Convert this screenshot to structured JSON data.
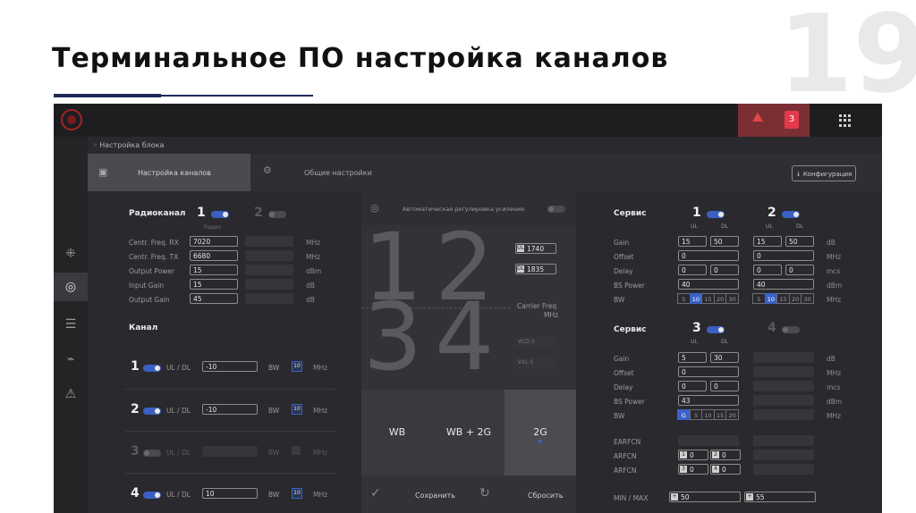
{
  "slide": {
    "title": "Терминальное ПО настройка каналов",
    "page_number": "19"
  },
  "topbar": {
    "alarm_count": "3"
  },
  "breadcrumb": "Настройка блока",
  "tabs": [
    {
      "label": "Настройка каналов"
    },
    {
      "label": "Общие настройки"
    }
  ],
  "config_button": "Конфигурация",
  "radio": {
    "header": "Радиоканал",
    "ch1": "1",
    "ch2": "2",
    "sub": "Радио",
    "rows": [
      {
        "label": "Centr. Freq. RX",
        "value": "7020",
        "unit": "MHz"
      },
      {
        "label": "Centr. Freq. TX",
        "value": "6680",
        "unit": "MHz"
      },
      {
        "label": "Output Power",
        "value": "15",
        "unit": "dBm"
      },
      {
        "label": "Input Gain",
        "value": "15",
        "unit": "dB"
      },
      {
        "label": "Output Gain",
        "value": "45",
        "unit": "dB"
      }
    ]
  },
  "channels": {
    "header": "Канал",
    "items": [
      {
        "num": "1",
        "mode": "UL / DL",
        "value": "-10",
        "bw_label": "BW",
        "bw": "10",
        "unit": "MHz"
      },
      {
        "num": "2",
        "mode": "UL / DL",
        "value": "-10",
        "bw_label": "BW",
        "bw": "10",
        "unit": "MHz"
      },
      {
        "num": "3",
        "mode": "UL / DL",
        "value": "",
        "bw_label": "BW",
        "bw": "",
        "unit": "MHz"
      },
      {
        "num": "4",
        "mode": "UL / DL",
        "value": "10",
        "bw_label": "BW",
        "bw": "10",
        "unit": "MHz"
      }
    ]
  },
  "center": {
    "agc_label": "Автоматическая регулировка усиления",
    "digits_top": "12",
    "digits_bottom": "34",
    "ul_label": "UL",
    "ul_value": "1740",
    "dl_label": "DL",
    "dl_value": "1835",
    "carrier_label": "Carrier Freq",
    "carrier_unit": "MHz",
    "dim_ul": "VCD.S",
    "dim_dl": "VVL.S",
    "modes": [
      {
        "label": "WB"
      },
      {
        "label": "WB + 2G"
      },
      {
        "label": "2G"
      }
    ],
    "save": "Сохранить",
    "reset": "Сбросить"
  },
  "service1": {
    "header": "Сервис",
    "col1": "1",
    "col2": "2",
    "ul": "UL",
    "dl": "DL",
    "rows": [
      {
        "label": "Gain",
        "a": "15",
        "b": "50",
        "c": "15",
        "d": "50",
        "unit": "dB"
      },
      {
        "label": "Offset",
        "a": "0",
        "b": "",
        "c": "0",
        "d": "",
        "unit": "MHz"
      },
      {
        "label": "Delay",
        "a": "0",
        "b": "0",
        "c": "0",
        "d": "0",
        "unit": "mcs"
      },
      {
        "label": "BS Power",
        "a": "40",
        "b": "",
        "c": "40",
        "d": "",
        "unit": "dBm"
      },
      {
        "label": "BW",
        "unit": "MHz"
      }
    ],
    "bw_options": [
      "5",
      "10",
      "15",
      "20",
      "30"
    ],
    "bw_selected": "10"
  },
  "service2": {
    "header": "Сервис",
    "col1": "3",
    "col2": "4",
    "ul": "UL",
    "dl": "DL",
    "rows": [
      {
        "label": "Gain",
        "a": "5",
        "b": "30",
        "unit": "dB"
      },
      {
        "label": "Offset",
        "a": "0",
        "b": "",
        "unit": "MHz"
      },
      {
        "label": "Delay",
        "a": "0",
        "b": "0",
        "unit": "mcs"
      },
      {
        "label": "BS Power",
        "a": "43",
        "b": "",
        "unit": "dBm"
      },
      {
        "label": "BW",
        "unit": "MHz"
      }
    ],
    "bw_options": [
      "G",
      "5",
      "10",
      "15",
      "20"
    ],
    "earfcn": "EARFCN",
    "arfcn1": {
      "label": "ARFCN",
      "p1": "1",
      "v1": "0",
      "p2": "2",
      "v2": "0"
    },
    "arfcn2": {
      "label": "ARFCN",
      "p1": "3",
      "v1": "0",
      "p2": "4",
      "v2": "0"
    },
    "minmax": {
      "label": "MIN / MAX",
      "v1": "50",
      "v2": "55"
    }
  }
}
